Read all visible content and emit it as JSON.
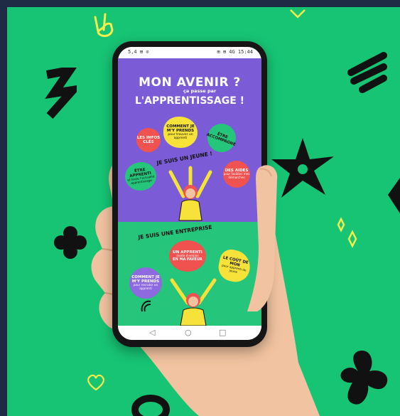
{
  "screen": {
    "status_left": "5,4 ⊞ ⊙",
    "status_right": "⊞ ⊞ 4G 15:44",
    "nav_back": "◁",
    "nav_home": "○",
    "nav_recent": "□",
    "headline_line1": "MON AVENIR ?",
    "headline_sub": "ça passe par",
    "headline_line2": "L'APPRENTISSAGE !",
    "young_section_title": "JE SUIS UN JEUNE !",
    "company_section_title": "JE SUIS UNE ENTREPRISE",
    "purple_bubbles": [
      {
        "title": "LES INFOS CLÉS"
      },
      {
        "title": "COMMENT JE M'Y PRENDS",
        "note": "pour trouver un apprenti"
      },
      {
        "title": "ÊTRE ACCOMPAGNÉ"
      },
      {
        "title": "ÊTRE APPRENTI",
        "note": "et toute l'actualité apprentissage"
      },
      {
        "title": "DES AIDES",
        "note": "pour faciliter mes démarches"
      }
    ],
    "green_bubbles": [
      {
        "title": "UN APPRENTI",
        "note": "mode d'emploi",
        "big": "EN MA FAVEUR"
      },
      {
        "title": "COMMENT JE M'Y PRENDS",
        "note": "pour recruter un apprenti"
      },
      {
        "title": "LE COÛT DE MON",
        "note": "pour apprenti de jeune"
      }
    ]
  },
  "colors": {
    "background_green": "#17c474",
    "frame_navy": "#1f2a44",
    "phone_purple": "#7b5cd6",
    "phone_green": "#25c57c",
    "bubble_yellow": "#f7e23a",
    "bubble_red": "#f0524f",
    "bubble_pink": "#e94d97",
    "bubble_purple": "#8e6ae0"
  },
  "icons": [
    "victory-hand-icon",
    "heart-outline-icon",
    "star-icon",
    "flower-icon",
    "sparkle-icon",
    "zigzag-icon",
    "ribbon-icon",
    "blob-icon"
  ]
}
